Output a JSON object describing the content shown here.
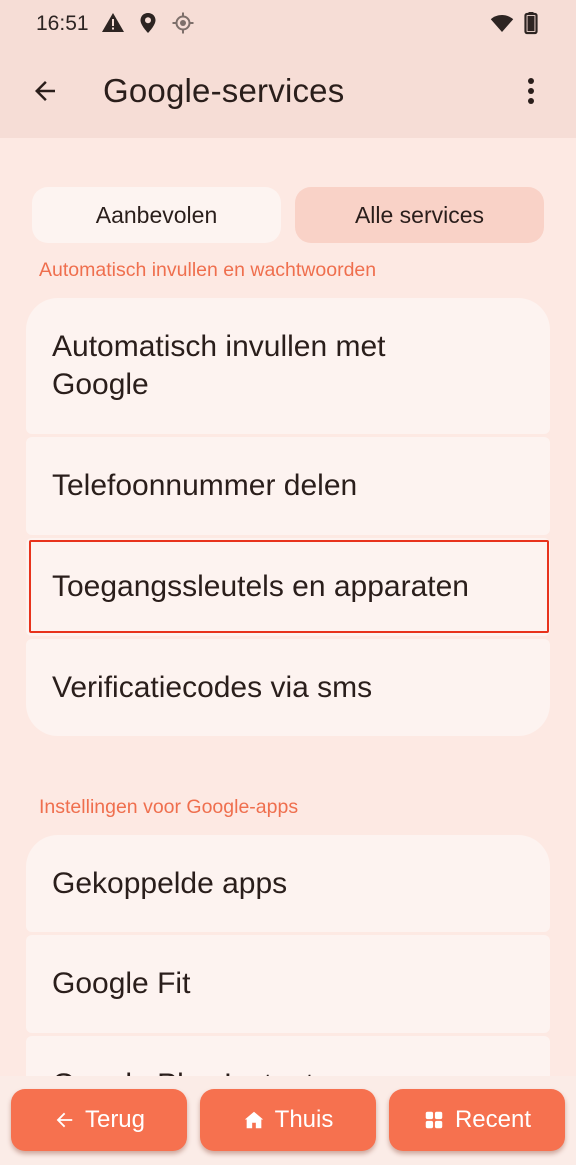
{
  "status_bar": {
    "time": "16:51",
    "icons": [
      "warning-icon",
      "location-pin-icon",
      "gps-icon",
      "wifi-icon",
      "battery-icon"
    ]
  },
  "app_bar": {
    "back_icon": "arrow-back-icon",
    "title": "Google-services",
    "more_icon": "more-vert-icon"
  },
  "tabs": [
    {
      "label": "Aanbevolen",
      "selected": false
    },
    {
      "label": "Alle services",
      "selected": true
    }
  ],
  "sections": [
    {
      "title": "Automatisch invullen en wachtwoorden",
      "items": [
        {
          "line1": "Automatisch invullen met",
          "line2": "Google"
        },
        {
          "label": "Telefoonnummer delen"
        },
        {
          "label": "Toegangssleutels en apparaten",
          "highlighted": true
        },
        {
          "label": "Verificatiecodes via sms"
        }
      ]
    },
    {
      "title": "Instellingen voor Google-apps",
      "items": [
        {
          "label": "Gekoppelde apps"
        },
        {
          "label": "Google Fit"
        },
        {
          "label": "Google Play Instant"
        }
      ]
    }
  ],
  "nav_buttons": [
    {
      "label": "Terug",
      "icon": "arrow-left-icon"
    },
    {
      "label": "Thuis",
      "icon": "home-icon"
    },
    {
      "label": "Recent",
      "icon": "grid-icon"
    }
  ],
  "colors": {
    "accent": "#ef6f4e",
    "nav_button": "#f6714f",
    "highlight_border": "#e8321c",
    "selected_tab": "#f9d2c7"
  }
}
